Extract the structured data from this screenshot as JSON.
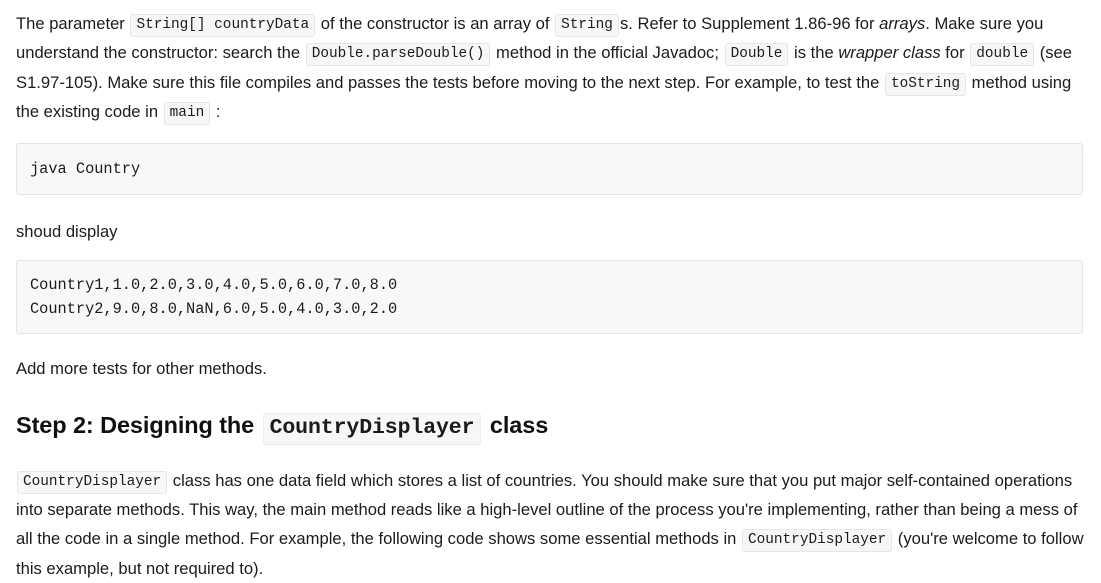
{
  "document": {
    "paragraph1": {
      "t1": "The parameter ",
      "code1": "String[] countryData",
      "t2": " of the constructor is an array of ",
      "code2": "String",
      "t3": "s. Refer to Supplement 1.86-96 for ",
      "em1": "arrays",
      "t4": ". Make sure you understand the constructor: search the ",
      "code3": "Double.parseDouble()",
      "t5": " method in the official Javadoc; ",
      "code4": "Double",
      "t6": " is the ",
      "em2": "wrapper class",
      "t7": " for ",
      "code5": "double",
      "t8": " (see S1.97-105). Make sure this file compiles and passes the tests before moving to the next step. For example, to test the ",
      "code6": "toString",
      "t9": " method using the existing code in ",
      "code7": "main",
      "t10": " :"
    },
    "codeblock1": "java Country",
    "paragraph2": "shoud display",
    "codeblock2": "Country1,1.0,2.0,3.0,4.0,5.0,6.0,7.0,8.0\nCountry2,9.0,8.0,NaN,6.0,5.0,4.0,3.0,2.0",
    "paragraph3": "Add more tests for other methods.",
    "heading": {
      "t1": "Step 2: Designing the ",
      "code1": "CountryDisplayer",
      "t2": " class"
    },
    "paragraph4": {
      "code1": "CountryDisplayer",
      "t1": " class has one data field which stores a list of countries. You should make sure that you put major self-contained operations into separate methods. This way, the main method reads like a high-level outline of the process you're implementing, rather than being a mess of all the code in a single method. For example, the following code shows some essential methods in ",
      "code2": "CountryDisplayer",
      "t2": " (you're welcome to follow this example, but not required to)."
    }
  },
  "colors": {
    "page_background": "#ffffff",
    "text": "#1b1b1b",
    "code_chip_background": "#f7f7f7",
    "code_chip_border": "#e6e6e6",
    "code_block_background": "#f8f8f8",
    "code_block_border": "#e4e4e4"
  }
}
